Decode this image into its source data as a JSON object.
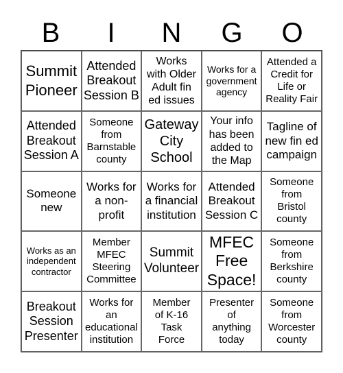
{
  "header": [
    "B",
    "I",
    "N",
    "G",
    "O"
  ],
  "cells": [
    "Summit\nPioneer",
    "Attended\nBreakout\nSession B",
    "Works\nwith Older\nAdult fin\ned issues",
    "Works for a\ngovernment\nagency",
    "Attended a\nCredit for\nLife or\nReality Fair",
    "Attended\nBreakout\nSession A",
    "Someone\nfrom\nBarnstable\ncounty",
    "Gateway\nCity\nSchool",
    "Your info\nhas been\nadded to\nthe Map",
    "Tagline of\nnew fin ed\ncampaign",
    "Someone\nnew",
    "Works for\na non-\nprofit",
    "Works for\na financial\ninstitution",
    "Attended\nBreakout\nSession C",
    "Someone\nfrom\nBristol\ncounty",
    "Works as an\nindependent\ncontractor",
    "Member\nMFEC\nSteering\nCommittee",
    "Summit\nVolunteer",
    "MFEC\nFree\nSpace!",
    "Someone\nfrom\nBerkshire\ncounty",
    "Breakout\nSession\nPresenter",
    "Works for\nan\neducational\ninstitution",
    "Member\nof K-16\nTask\nForce",
    "Presenter\nof\nanything\ntoday",
    "Someone\nfrom\nWorcester\ncounty"
  ]
}
